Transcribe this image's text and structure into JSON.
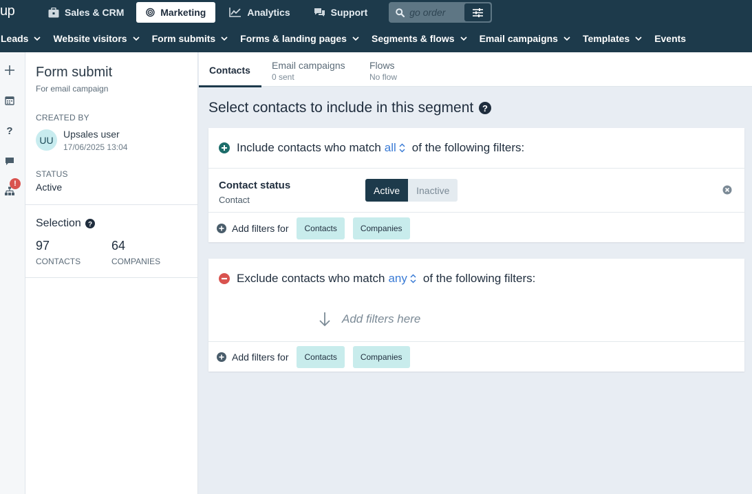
{
  "topnav": {
    "logo": "up",
    "items": [
      {
        "label": "Sales & CRM",
        "icon": "briefcase-icon"
      },
      {
        "label": "Marketing",
        "icon": "bullseye-icon",
        "active": true
      },
      {
        "label": "Analytics",
        "icon": "line-chart-icon"
      },
      {
        "label": "Support",
        "icon": "chat-bubbles-icon"
      }
    ],
    "search_placeholder": "go order"
  },
  "subnav": {
    "items": [
      "Leads",
      "Website visitors",
      "Form submits",
      "Forms & landing pages",
      "Segments & flows",
      "Email campaigns",
      "Templates",
      "Events"
    ]
  },
  "rail": {
    "icons": [
      "plus-icon",
      "calendar-icon",
      "help-icon",
      "comment-icon",
      "sitemap-icon"
    ],
    "badge": "!"
  },
  "side": {
    "title": "Form submit",
    "subtitle": "For email campaign",
    "created_by_label": "CREATED BY",
    "avatar_initials": "UU",
    "user_name": "Upsales user",
    "user_date": "17/06/2025 13:04",
    "status_label": "STATUS",
    "status_value": "Active",
    "selection_title": "Selection",
    "contacts_count": "97",
    "contacts_label": "CONTACTS",
    "companies_count": "64",
    "companies_label": "COMPANIES"
  },
  "tabs": [
    {
      "label": "Contacts",
      "sub": ""
    },
    {
      "label": "Email campaigns",
      "sub": "0 sent"
    },
    {
      "label": "Flows",
      "sub": "No flow"
    }
  ],
  "main": {
    "heading": "Select contacts to include in this segment",
    "include": {
      "prefix": "Include contacts who match",
      "match": "all",
      "suffix": "of the following filters:",
      "filter_name": "Contact status",
      "filter_sub": "Contact",
      "toggle_on": "Active",
      "toggle_off": "Inactive",
      "add_label": "Add filters for",
      "chip_contacts": "Contacts",
      "chip_companies": "Companies"
    },
    "exclude": {
      "prefix": "Exclude contacts who match",
      "match": "any",
      "suffix": "of the following filters:",
      "drop_hint": "Add filters here",
      "add_label": "Add filters for",
      "chip_contacts": "Contacts",
      "chip_companies": "Companies"
    }
  },
  "colors": {
    "nav_bg": "#1d3a4b",
    "accent_blue": "#3a7bd5",
    "chip_bg": "#c8ecec",
    "include_green": "#1d6d6a",
    "exclude_red": "#d9534f"
  }
}
